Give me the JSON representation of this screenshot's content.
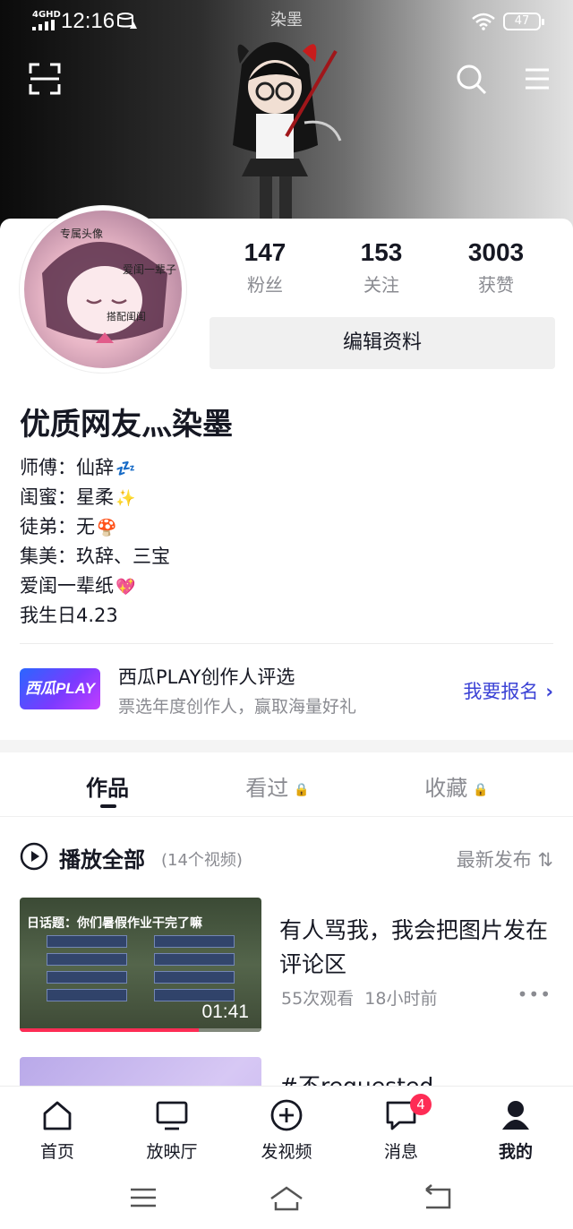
{
  "status_bar": {
    "network": "4GHD",
    "time": "12:16",
    "center_title": "染墨",
    "battery": "47"
  },
  "header": {
    "icons": [
      "scan-icon",
      "search-icon",
      "menu-icon"
    ]
  },
  "profile": {
    "stats": [
      {
        "value": "147",
        "label": "粉丝"
      },
      {
        "value": "153",
        "label": "关注"
      },
      {
        "value": "3003",
        "label": "获赞"
      }
    ],
    "edit_label": "编辑资料",
    "nickname": "优质网友灬染墨",
    "bio": [
      {
        "text": "师傅：仙辞",
        "emoji": "💤"
      },
      {
        "text": "闺蜜：星柔",
        "emoji": "✨"
      },
      {
        "text": "徒弟：无",
        "emoji": "🍄"
      },
      {
        "text": "集美：玖辞、三宝",
        "emoji": ""
      },
      {
        "text": "爱闺一辈纸",
        "emoji": "💖"
      },
      {
        "text": "我生日4.23",
        "emoji": ""
      }
    ]
  },
  "promo": {
    "logo_text": "西瓜PLAY",
    "title": "西瓜PLAY创作人评选",
    "subtitle": "票选年度创作人，赢取海量好礼",
    "cta": "我要报名"
  },
  "tabs": [
    {
      "label": "作品",
      "locked": false,
      "active": true
    },
    {
      "label": "看过",
      "locked": true,
      "active": false
    },
    {
      "label": "收藏",
      "locked": true,
      "active": false
    }
  ],
  "play_all": {
    "label": "播放全部",
    "count": "(14个视频)",
    "sort_label": "最新发布"
  },
  "videos": [
    {
      "thumb_title": "日话题：你们暑假作业干完了嘛",
      "duration": "01:41",
      "progress": 0.74,
      "title": "有人骂我，我会把图片发在评论区",
      "views": "55次观看",
      "time_ago": "18小时前"
    },
    {
      "title": "#不requested"
    }
  ],
  "bottom_nav": [
    {
      "label": "首页",
      "icon": "home-icon"
    },
    {
      "label": "放映厅",
      "icon": "tv-icon"
    },
    {
      "label": "发视频",
      "icon": "add-icon"
    },
    {
      "label": "消息",
      "icon": "message-icon",
      "badge": "4"
    },
    {
      "label": "我的",
      "icon": "profile-icon"
    }
  ],
  "colors": {
    "accent": "#fe2c55",
    "link": "#3c43d6",
    "secondary_text": "#8a8b91"
  }
}
